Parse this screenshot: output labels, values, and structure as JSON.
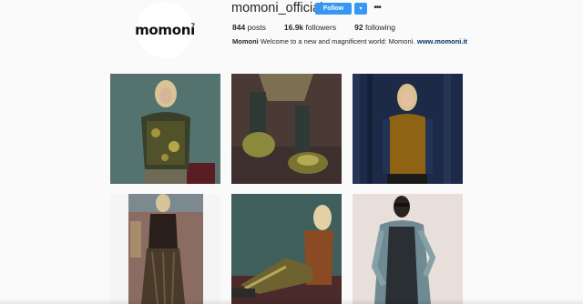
{
  "profile": {
    "logo_text": "momonỉ",
    "username": "momoni_official",
    "follow_label": "Follow",
    "dropdown_icon": "caret-down-icon",
    "more_icon": "more-horizontal-icon",
    "accent_color": "#3897f0"
  },
  "stats": {
    "posts": {
      "value": "844",
      "label": "posts"
    },
    "followers": {
      "value": "16.9k",
      "label": "followers"
    },
    "following": {
      "value": "92",
      "label": "following"
    }
  },
  "bio": {
    "name": "Momonì",
    "text": "Welcome to a new and magnificent world: Momonì.",
    "link": "www.momoni.it"
  },
  "posts": [
    {
      "alt": "post-1"
    },
    {
      "alt": "post-2"
    },
    {
      "alt": "post-3"
    },
    {
      "alt": "post-4"
    },
    {
      "alt": "post-5"
    },
    {
      "alt": "post-6"
    }
  ]
}
